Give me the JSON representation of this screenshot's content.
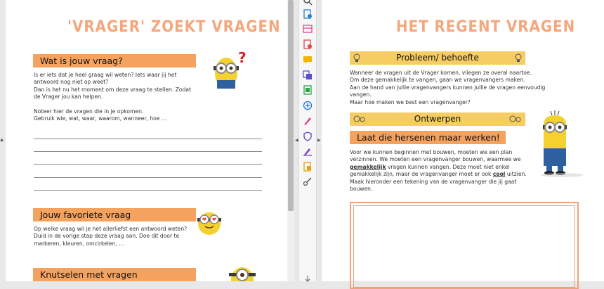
{
  "left_page": {
    "title": "'VRAGER' ZOEKT VRAGEN",
    "section1": {
      "heading": "Wat is jouw vraag?",
      "text": "Is er iets dat je heel graag wil weten? Iets waar jij het\nantwoord nog niet op weet?\nDan is het nu het moment om deze vraag te stellen. Zodat\nde Vrager jou kan helpen.\n\nNoteer hier de vragen die in je opkomen.\nGebruik wie, wat, waar, waarom, wanneer, hoe …",
      "question_mark": "?"
    },
    "section2": {
      "heading": "Jouw favoriete vraag",
      "text": "Op welke vraag wil je het allerliefst een antwoord weten?\nDuid in de vorige stap deze vraag aan. Doe dit door te\nmarkeren, kleuren, omcirkelen, …"
    },
    "section3": {
      "heading": "Knutselen met vragen"
    }
  },
  "right_page": {
    "title": "HET REGENT VRAGEN",
    "problem": {
      "heading": "Probleem/ behoefte",
      "text": "Wanneer de vragen uit de Vrager komen, vliegen ze overal naartoe.\nOm deze gemakkelijk te vangen, gaan we vragenvangers maken.\nAan de hand van jullie vragenvangers kunnen jullie de vragen eenvoudig vangen.\nMaar hoe maken we best een vragenvanger?"
    },
    "design": {
      "heading": "Ontwerpen",
      "subheading": "Laat die hersenen maar werken!",
      "text_parts": [
        "Voor we kunnen beginnen met bouwen, moeten we een plan\nverzinnen. We moeten een vragenvanger bouwen, waarmee we\n",
        "gemakkelijk",
        " vragen kunnen vangen. Deze moet niet enkel\ngemakkelijk zijn, maar de vragenvanger moet er ook ",
        "cool",
        " uitzien.\nMaak hieronder een tekening van de vragenvanger die jij gaat\nbouwen."
      ]
    }
  },
  "toolbar": {
    "icons": [
      "search-icon",
      "add-page-icon",
      "layout-icon",
      "export-pdf-icon",
      "comment-icon",
      "combine-icon",
      "organize-icon",
      "compress-icon",
      "sign-icon",
      "protect-icon",
      "fill-sign-icon",
      "stamp-icon",
      "more-tools-icon"
    ]
  },
  "colors": {
    "orange_banner": "#f6a25f",
    "yellow_banner": "#f6cd63",
    "title_orange": "#f4a77c",
    "frame_orange": "#f0a07a"
  }
}
